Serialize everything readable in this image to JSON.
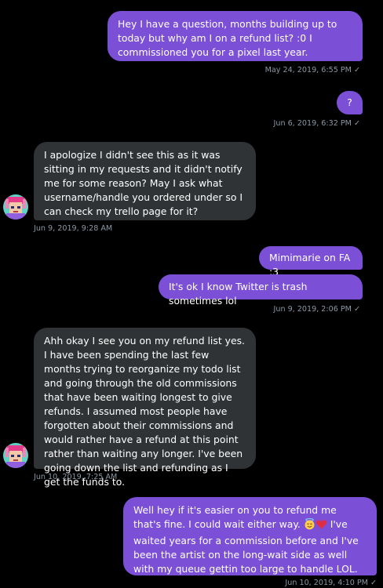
{
  "colors": {
    "outgoing_bubble": "#7b4fd6",
    "incoming_bubble": "#2f3336",
    "meta_text": "#8b98a5",
    "background": "#000000"
  },
  "messages": [
    {
      "id": "m1",
      "direction": "outgoing",
      "text": "Hey I have a question, months building up to today but why am I on a refund list? :0 I commissioned you for a pixel last year.",
      "time": "May 24, 2019, 6:55 PM",
      "status_icon": "read-check-icon"
    },
    {
      "id": "m2",
      "direction": "outgoing",
      "text": "?",
      "time": "Jun 6, 2019, 6:32 PM",
      "status_icon": "read-check-icon"
    },
    {
      "id": "m3",
      "direction": "incoming",
      "text": "I apologize I didn't see this as it was sitting in my requests and it didn't notify me for some reason? May I ask what username/handle you ordered under so I can check my trello page for it?",
      "time": "Jun 9, 2019, 9:28 AM",
      "avatar_icon": "pixel-avatar-icon"
    },
    {
      "id": "m4",
      "direction": "outgoing",
      "text": "Mimimarie on FA :3",
      "time": "",
      "status_icon": ""
    },
    {
      "id": "m5",
      "direction": "outgoing",
      "text": "It's ok I know Twitter is trash sometimes lol",
      "time": "Jun 9, 2019, 2:06 PM",
      "status_icon": "read-check-icon"
    },
    {
      "id": "m6",
      "direction": "incoming",
      "text": "Ahh okay I see you on my refund list yes. I have been spending the last few months trying to reorganize my todo list and going through the old commissions that have been waiting longest to give refunds. I assumed most people have forgotten about their commissions and would rather have a refund at this point rather than waiting any longer. I've been going down the list and refunding as I get the funds to.",
      "time": "Jun 10, 2019, 7:25 AM",
      "avatar_icon": "pixel-avatar-icon"
    },
    {
      "id": "m7",
      "direction": "outgoing",
      "text_before_emoji": "Well hey if it's easier on you to refund me that's fine. I could wait either way.",
      "emojis": [
        "smiling-face-with-halo-icon",
        "red-heart-icon"
      ],
      "text_after_emoji": "I've waited years for a commission before and I've been the artist on the long-wait side as well with my queue gettin too large to handle LOL.",
      "time": "Jun 10, 2019, 4:10 PM",
      "status_icon": "read-check-icon"
    }
  ],
  "check_glyph": "✓"
}
